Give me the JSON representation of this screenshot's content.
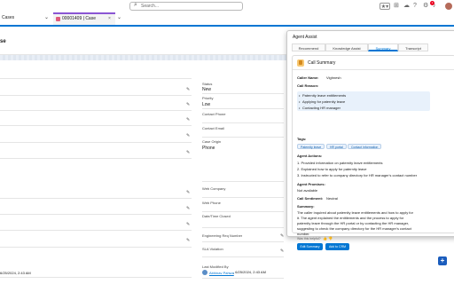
{
  "header": {
    "search_placeholder": "Search...",
    "notification_count": "1"
  },
  "nav": {
    "app_name": "Cases",
    "tab_label": "00001409 | Case"
  },
  "record": {
    "title_fragment": "se"
  },
  "fields": {
    "status_label": "Status",
    "status_value": "New",
    "priority_label": "Priority",
    "priority_value": "Low",
    "contact_phone_label": "Contact Phone",
    "contact_email_label": "Contact Email",
    "case_origin_label": "Case Origin",
    "case_origin_value": "Phone",
    "web_company_label": "Web Company",
    "web_phone_label": "Web Phone",
    "date_time_closed_label": "Date/Time Closed",
    "eng_req_label": "Engineering Req Number",
    "sla_label": "SLA Violation",
    "last_modified_label": "Last Modified By",
    "last_modified_user": "Abhinav Pahwa",
    "last_modified_date": ", 6/25/2024, 2:43 AM",
    "created_fragment": "6/25/2024, 2:43 AM"
  },
  "assist": {
    "title": "Agent Assist",
    "tabs": [
      "Recommend",
      "Knowledge Assist",
      "Summary",
      "Transcript"
    ],
    "active_tab": "Summary",
    "card_title": "Call Summary",
    "caller_name_label": "Caller Name:",
    "caller_name_value": "Vighnesh",
    "call_reason_label": "Call Reason:",
    "reasons": [
      "Paternity leave entitlements",
      "Applying for paternity leave",
      "Contacting HR manager"
    ],
    "tags_label": "Tags:",
    "tags": [
      "Paternity leave",
      "HR portal",
      "Contact information"
    ],
    "agent_actions_label": "Agent Actions:",
    "actions": [
      "1. Provided information on paternity leave entitlements",
      "2. Explained how to apply for paternity leave",
      "3. Instructed to refer to company directory for HR manager's contact number"
    ],
    "promises_label": "Agent Promises:",
    "promises_value": "Not available",
    "sentiment_label": "Call Sentiment:",
    "sentiment_value": "Neutral",
    "summary_label": "Summary:",
    "summary_lines": [
      "The caller inquired about paternity leave entitlements and how to apply for",
      "it. The agent explained the entitlements and the process to apply for",
      "paternity leave through the HR portal or by contacting the HR manager,",
      "suggesting to check the company directory for the HR manager's contact",
      "number."
    ],
    "helpful_text": "Was this helpful?",
    "edit_button": "Edit Summary",
    "add_crm_button": "Add to CRM"
  },
  "icons": {
    "search": "search-icon",
    "favorite": "star-icon",
    "notification": "bell-icon",
    "setup": "gear-icon",
    "utility": "plus-icon"
  },
  "colors": {
    "brand": "#0176d3",
    "tab_accent": "#8a55d3",
    "reason_bg": "#e8f1fb"
  }
}
